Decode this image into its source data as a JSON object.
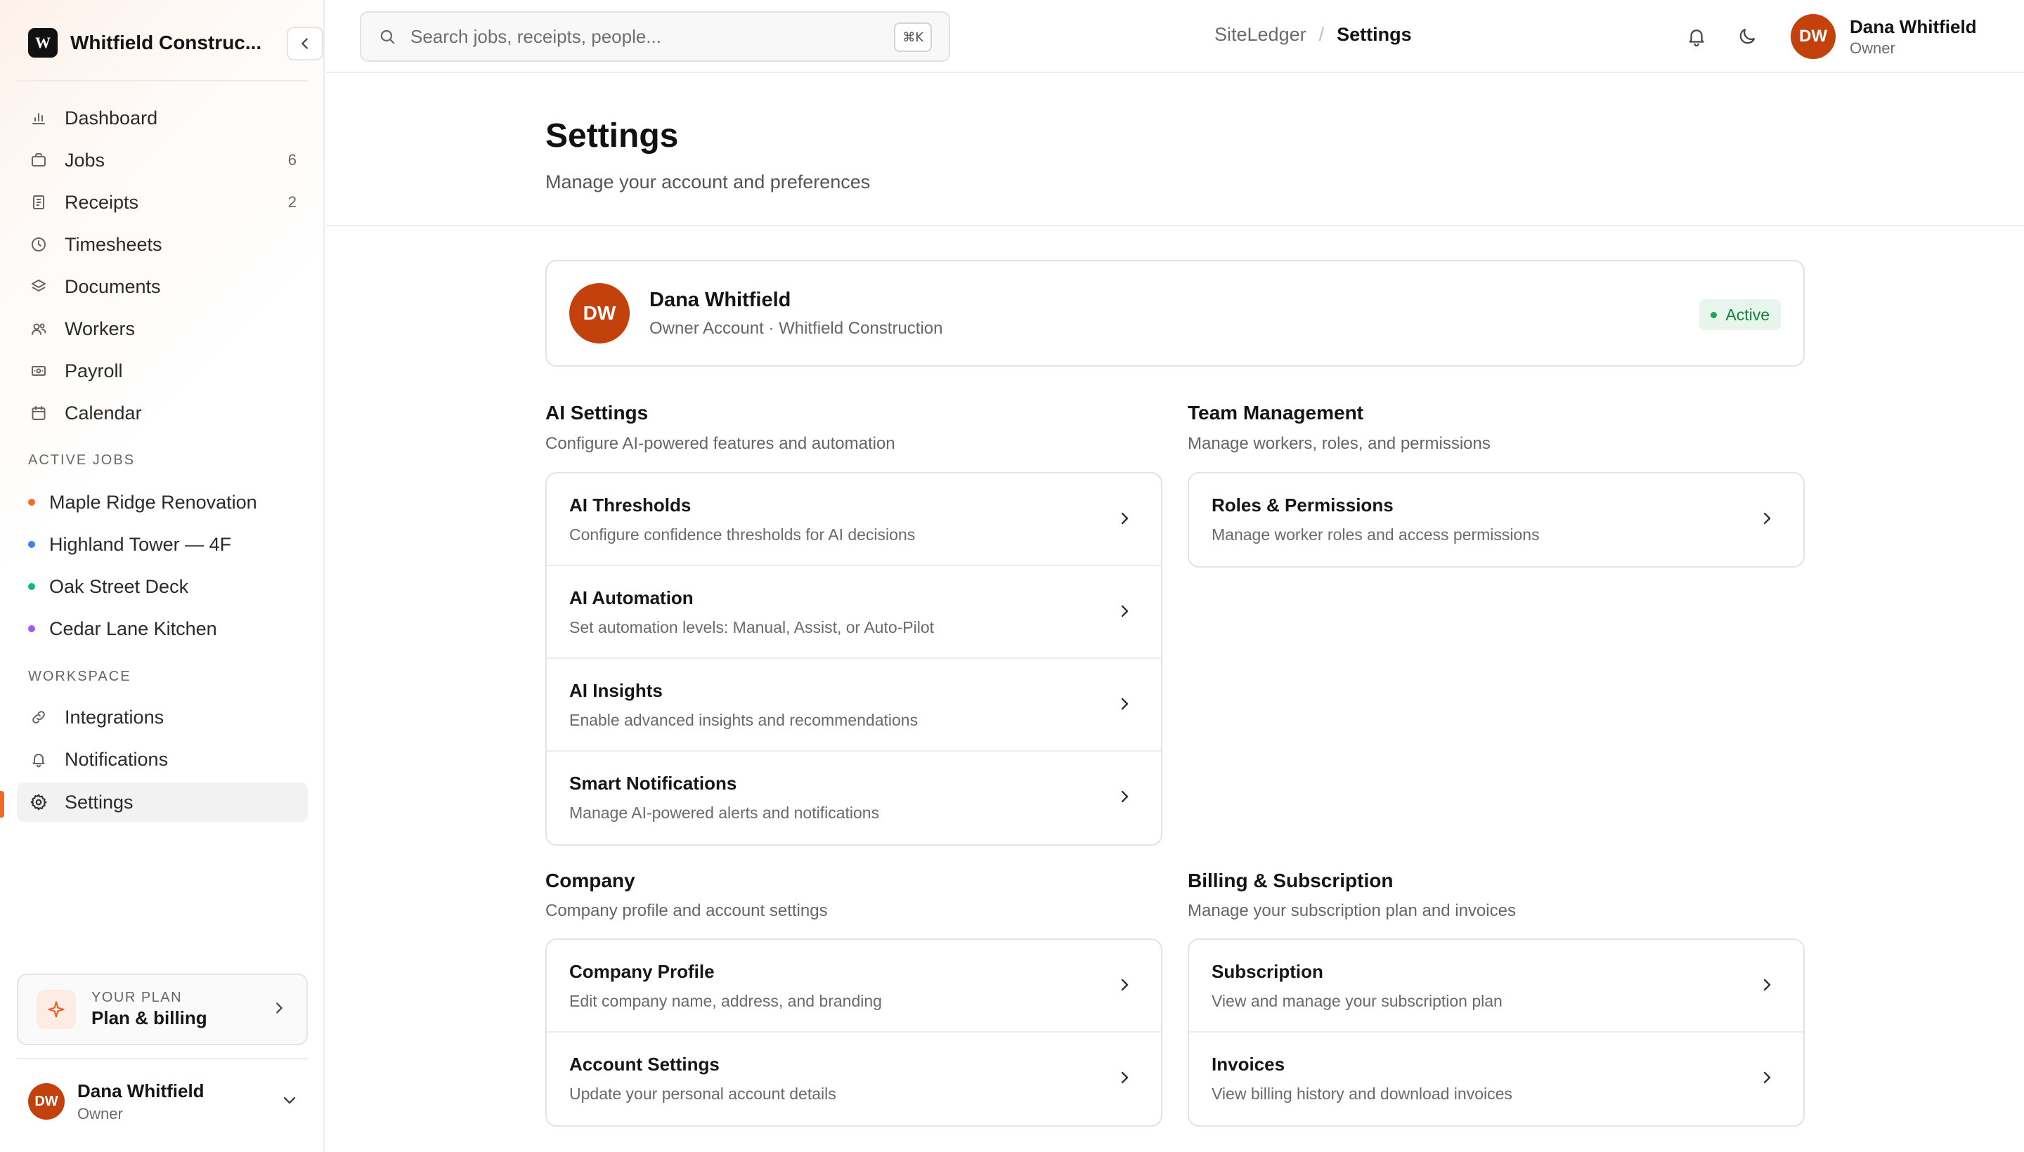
{
  "brand": {
    "logo_letter": "W",
    "name": "Whitfield Construc..."
  },
  "nav": [
    {
      "label": "Dashboard",
      "icon": "bar-chart-icon",
      "count": ""
    },
    {
      "label": "Jobs",
      "icon": "briefcase-icon",
      "count": "6"
    },
    {
      "label": "Receipts",
      "icon": "receipt-icon",
      "count": "2"
    },
    {
      "label": "Timesheets",
      "icon": "clock-icon",
      "count": ""
    },
    {
      "label": "Documents",
      "icon": "layers-icon",
      "count": ""
    },
    {
      "label": "Workers",
      "icon": "users-icon",
      "count": ""
    },
    {
      "label": "Payroll",
      "icon": "banknote-icon",
      "count": ""
    },
    {
      "label": "Calendar",
      "icon": "calendar-icon",
      "count": ""
    }
  ],
  "active_jobs": {
    "label": "ACTIVE JOBS",
    "items": [
      {
        "label": "Maple Ridge Renovation",
        "color": "#f26a2e"
      },
      {
        "label": "Highland Tower — 4F",
        "color": "#3b82f6"
      },
      {
        "label": "Oak Street Deck",
        "color": "#10b981"
      },
      {
        "label": "Cedar Lane Kitchen",
        "color": "#a855f7"
      }
    ]
  },
  "workspace": {
    "label": "WORKSPACE",
    "items": [
      {
        "label": "Integrations",
        "icon": "link-icon"
      },
      {
        "label": "Notifications",
        "icon": "bell-icon"
      },
      {
        "label": "Settings",
        "icon": "gear-icon",
        "active": true
      }
    ]
  },
  "plan": {
    "kicker": "YOUR PLAN",
    "title": "Plan & billing"
  },
  "sidebar_user": {
    "initials": "DW",
    "name": "Dana Whitfield",
    "role": "Owner"
  },
  "search": {
    "placeholder": "Search jobs, receipts, people...",
    "shortcut": "⌘K"
  },
  "breadcrumb": {
    "root": "SiteLedger",
    "separator": "/",
    "current": "Settings"
  },
  "top_user": {
    "initials": "DW",
    "name": "Dana Whitfield",
    "role": "Owner"
  },
  "page": {
    "title": "Settings",
    "subtitle": "Manage your account and preferences"
  },
  "profile": {
    "initials": "DW",
    "name": "Dana Whitfield",
    "meta": "Owner Account · Whitfield Construction",
    "status": "Active",
    "status_color": "#15803d"
  },
  "sections": {
    "ai": {
      "title": "AI Settings",
      "subtitle": "Configure AI-powered features and automation",
      "items": [
        {
          "title": "AI Thresholds",
          "desc": "Configure confidence thresholds for AI decisions"
        },
        {
          "title": "AI Automation",
          "desc": "Set automation levels: Manual, Assist, or Auto-Pilot"
        },
        {
          "title": "AI Insights",
          "desc": "Enable advanced insights and recommendations"
        },
        {
          "title": "Smart Notifications",
          "desc": "Manage AI-powered alerts and notifications"
        }
      ]
    },
    "team": {
      "title": "Team Management",
      "subtitle": "Manage workers, roles, and permissions",
      "items": [
        {
          "title": "Roles & Permissions",
          "desc": "Manage worker roles and access permissions"
        }
      ]
    },
    "company": {
      "title": "Company",
      "subtitle": "Company profile and account settings",
      "items": [
        {
          "title": "Company Profile",
          "desc": "Edit company name, address, and branding"
        },
        {
          "title": "Account Settings",
          "desc": "Update your personal account details"
        }
      ]
    },
    "billing": {
      "title": "Billing & Subscription",
      "subtitle": "Manage your subscription plan and invoices",
      "items": [
        {
          "title": "Subscription",
          "desc": "View and manage your subscription plan"
        },
        {
          "title": "Invoices",
          "desc": "View billing history and download invoices"
        }
      ]
    }
  },
  "accent_color": "#f06a2a",
  "avatar_color": "#c2410c"
}
